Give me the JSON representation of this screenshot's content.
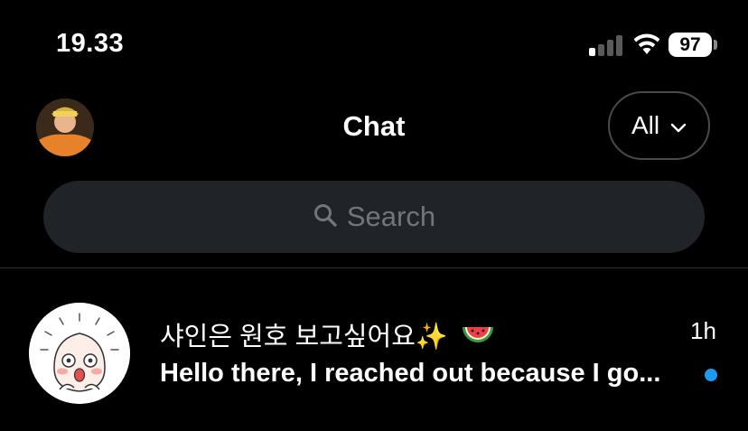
{
  "status_bar": {
    "time": "19.33",
    "battery": "97",
    "signal_bars": 1,
    "signal_total": 4
  },
  "header": {
    "title": "Chat",
    "filter_label": "All",
    "filter_icon": "chevron-down-icon",
    "avatar_icon": "user-avatar"
  },
  "search": {
    "placeholder": "Search",
    "icon": "search-icon"
  },
  "chats": [
    {
      "name": "샤인은 원호 보고싶어요✨",
      "name_emoji": "watermelon-icon",
      "time": "1h",
      "preview": "Hello there, I reached out because I go...",
      "unread": true,
      "avatar_icon": "peach-character-avatar"
    }
  ],
  "colors": {
    "background": "#000000",
    "accent": "#1d9bf0",
    "search_bg": "#202327",
    "placeholder": "#71767b"
  }
}
